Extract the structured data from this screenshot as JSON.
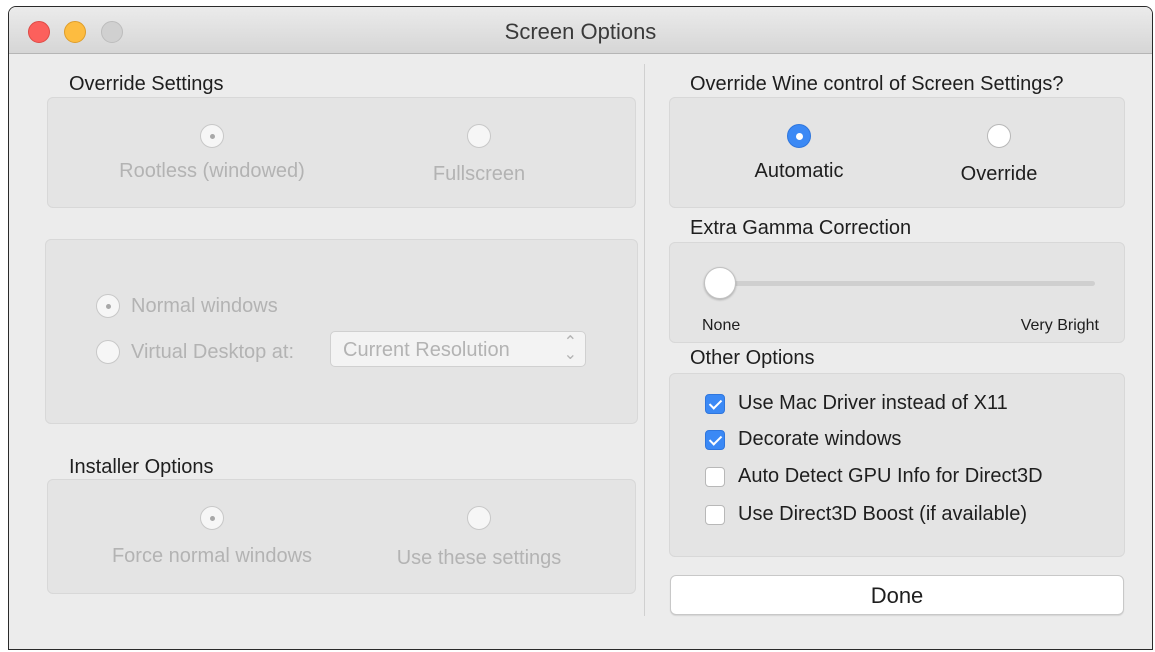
{
  "window": {
    "title": "Screen Options"
  },
  "override_settings": {
    "label": "Override Settings",
    "options": [
      {
        "label": "Rootless (windowed)",
        "selected": true
      },
      {
        "label": "Fullscreen",
        "selected": false
      }
    ]
  },
  "window_mode": {
    "options": [
      {
        "label": "Normal windows",
        "selected": true
      },
      {
        "label": "Virtual Desktop at:",
        "selected": false
      }
    ],
    "resolution_select": {
      "value": "Current Resolution",
      "icon": "chevron-updown-icon"
    }
  },
  "installer_options": {
    "label": "Installer Options",
    "options": [
      {
        "label": "Force normal windows",
        "selected": true
      },
      {
        "label": "Use these settings",
        "selected": false
      }
    ]
  },
  "wine_control": {
    "label": "Override Wine control of Screen Settings?",
    "options": [
      {
        "label": "Automatic",
        "selected": true
      },
      {
        "label": "Override",
        "selected": false
      }
    ]
  },
  "gamma": {
    "label": "Extra Gamma Correction",
    "min_label": "None",
    "max_label": "Very Bright",
    "value_fraction": 0.0
  },
  "other_options": {
    "label": "Other Options",
    "items": [
      {
        "label": "Use Mac Driver instead of X11",
        "checked": true
      },
      {
        "label": "Decorate windows",
        "checked": true
      },
      {
        "label": "Auto Detect GPU Info for Direct3D",
        "checked": false
      },
      {
        "label": "Use Direct3D Boost (if available)",
        "checked": false
      }
    ]
  },
  "done_button": {
    "label": "Done"
  },
  "colors": {
    "accent": "#3b89f5",
    "disabled_text": "#b3b3b3",
    "window_bg": "#ececec"
  }
}
